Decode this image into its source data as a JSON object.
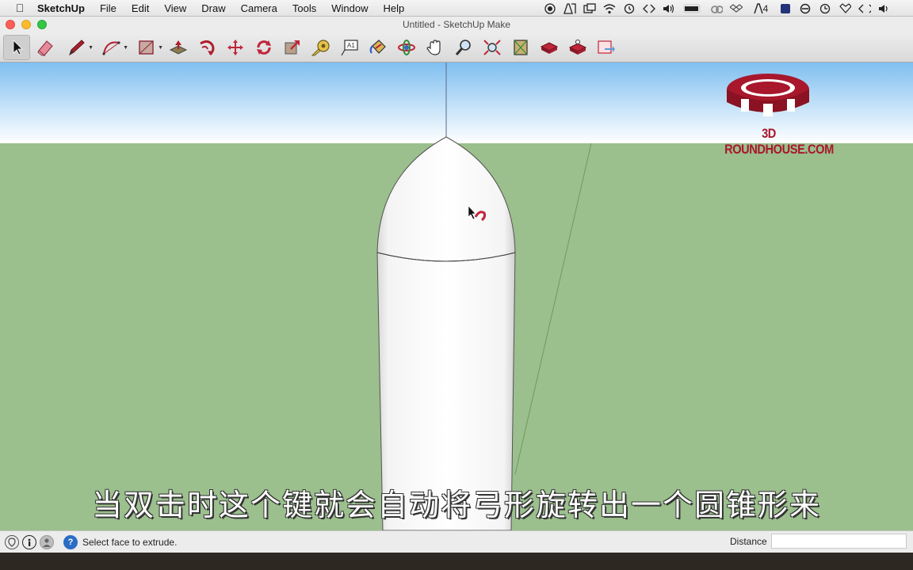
{
  "menubar": {
    "app_name": "SketchUp",
    "items": [
      "File",
      "Edit",
      "View",
      "Draw",
      "Camera",
      "Tools",
      "Window",
      "Help"
    ],
    "extras_text": "4"
  },
  "window": {
    "title": "Untitled - SketchUp Make"
  },
  "toolbar": {
    "tools": [
      {
        "name": "select-tool",
        "icon": "arrow-cursor-icon"
      },
      {
        "name": "eraser-tool",
        "icon": "eraser-icon"
      },
      {
        "name": "pencil-tool",
        "icon": "pencil-icon"
      },
      {
        "name": "arc-tool",
        "icon": "arc-icon"
      },
      {
        "name": "rectangle-tool",
        "icon": "rectangle-icon"
      },
      {
        "name": "push-pull-tool",
        "icon": "push-pull-icon"
      },
      {
        "name": "follow-me-tool",
        "icon": "follow-me-icon"
      },
      {
        "name": "move-tool",
        "icon": "move-icon"
      },
      {
        "name": "rotate-tool",
        "icon": "rotate-icon"
      },
      {
        "name": "scale-tool",
        "icon": "scale-icon"
      },
      {
        "name": "tape-measure-tool",
        "icon": "tape-measure-icon"
      },
      {
        "name": "text-tool",
        "icon": "text-icon"
      },
      {
        "name": "paint-bucket-tool",
        "icon": "paint-bucket-icon"
      },
      {
        "name": "orbit-tool",
        "icon": "orbit-icon"
      },
      {
        "name": "pan-tool",
        "icon": "pan-hand-icon"
      },
      {
        "name": "zoom-tool",
        "icon": "zoom-icon"
      },
      {
        "name": "zoom-extents-tool",
        "icon": "zoom-extents-icon"
      },
      {
        "name": "3d-warehouse-tool",
        "icon": "warehouse-icon"
      },
      {
        "name": "extension-warehouse-tool",
        "icon": "extension-icon"
      },
      {
        "name": "share-model-tool",
        "icon": "share-model-icon"
      },
      {
        "name": "send-to-layout-tool",
        "icon": "layout-icon"
      }
    ],
    "text_tool_label": "A1"
  },
  "viewport": {
    "logo_text": "3D ROUNDHOUSE.COM",
    "subtitle": "当双击时这个键就会自动将弓形旋转出一个圆锥形来",
    "colors": {
      "sky_top": "#7fbff0",
      "ground": "#9bbf8d",
      "accent": "#a8172b"
    }
  },
  "statusbar": {
    "message": "Select face to extrude.",
    "vcb_label": "Distance",
    "vcb_value": ""
  }
}
